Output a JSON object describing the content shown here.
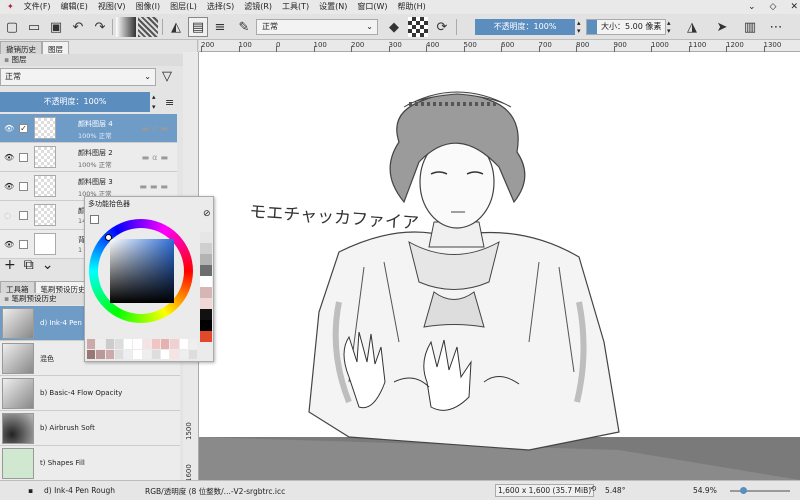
{
  "menubar": {
    "items": [
      "文件(F)",
      "编辑(E)",
      "视图(V)",
      "图像(I)",
      "图层(L)",
      "选择(S)",
      "滤镜(R)",
      "工具(T)",
      "设置(N)",
      "窗口(W)",
      "帮助(H)"
    ]
  },
  "toolbar": {
    "blend_mode": "正常",
    "opacity_label": "不透明度：100%",
    "size_label": "大小：5.00 像素"
  },
  "left_dock": {
    "tabs": [
      "撤销历史",
      "图层"
    ],
    "layers_header": "图层",
    "blend_mode": "正常",
    "opacity_label": "不透明度：100%",
    "layers": [
      {
        "name": "颜料图层 4",
        "sub": "100% 正常",
        "selected": true
      },
      {
        "name": "颜料图层 2",
        "sub": "100% 正常",
        "selected": false
      },
      {
        "name": "颜料图层 3",
        "sub": "100% 正常",
        "selected": false
      },
      {
        "name": "颜",
        "sub": "14",
        "selected": false
      },
      {
        "name": "背",
        "sub": "1",
        "selected": false
      }
    ],
    "bottom_tabs": [
      "工具箱",
      "笔刷预设历史"
    ],
    "brush_header": "笔刷预设历史",
    "brushes": [
      {
        "name": "d) Ink-4 Pen Rough",
        "selected": true
      },
      {
        "name": "混色",
        "selected": false
      },
      {
        "name": "b) Basic-4 Flow Opacity",
        "selected": false
      },
      {
        "name": "b) Airbrush Soft",
        "selected": false
      },
      {
        "name": "t) Shapes Fill",
        "selected": false
      }
    ]
  },
  "color_selector": {
    "title": "多功能拾色器",
    "accent_blue": "#2e6fd9"
  },
  "rulers": {
    "h_ticks": [
      "200",
      "100",
      "0",
      "100",
      "200",
      "300",
      "400",
      "500",
      "600",
      "700",
      "800",
      "900",
      "1000",
      "1100",
      "1200",
      "1300",
      "1400"
    ],
    "v_ticks": [
      "1500",
      "1600"
    ]
  },
  "canvas": {
    "handwritten_text": "モエチャッカファイア"
  },
  "statusbar": {
    "brush": "d) Ink-4 Pen Rough",
    "colorspace": "RGB/透明度 (8 位整数/...-V2-srgbtrc.icc",
    "dimensions": "1,600 x 1,600 (35.7 MiB)",
    "rotation": "5.48°",
    "zoom": "54.9%"
  }
}
